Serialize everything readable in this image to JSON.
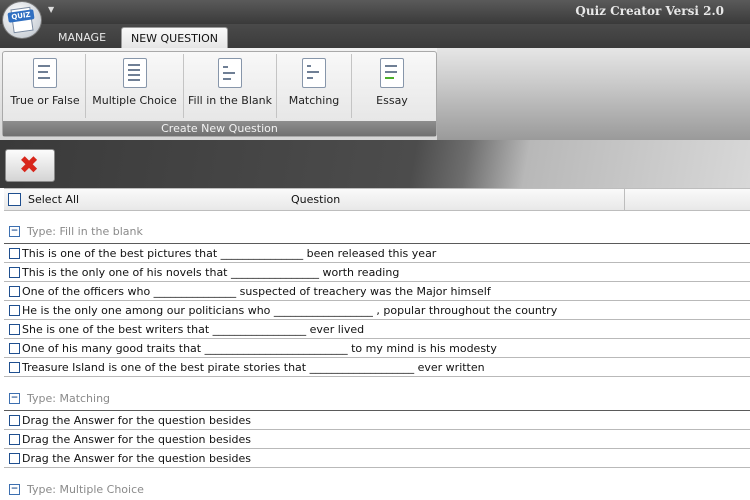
{
  "app": {
    "title": "Quiz Creator Versi 2.0",
    "icon_badge": "QUIZ"
  },
  "tabs": [
    {
      "label": "MANAGE"
    },
    {
      "label": "NEW QUESTION",
      "selected": true
    }
  ],
  "ribbon": {
    "group_label": "Create New Question",
    "buttons": [
      {
        "label": "True or False",
        "icon": "true-false-icon"
      },
      {
        "label": "Multiple Choice",
        "icon": "multiple-choice-icon"
      },
      {
        "label": "Fill in the Blank",
        "icon": "fill-blank-icon"
      },
      {
        "label": "Matching",
        "icon": "matching-icon"
      },
      {
        "label": "Essay",
        "icon": "essay-icon"
      }
    ]
  },
  "toolbar": {
    "delete_icon": "delete-icon",
    "delete_color": "#d8261b"
  },
  "grid": {
    "select_all_label": "Select All",
    "column_question": "Question",
    "groups": [
      {
        "title": "Type: Fill in the blank",
        "rows": [
          "This is one of the best pictures that _______________ been released this year",
          "This is the only one of his novels that ________________ worth reading",
          "One of the officers who _______________ suspected of treachery was the Major himself",
          "He is the only one among our politicians who __________________ , popular throughout the country",
          "She is one of the best writers that _________________ ever lived",
          "One of his many good traits that __________________________ to my mind is his modesty",
          "Treasure Island is one of the best pirate stories that ___________________ ever written"
        ]
      },
      {
        "title": "Type: Matching",
        "rows": [
          "Drag the Answer for the question besides",
          "Drag the Answer for the question besides",
          "Drag the Answer for the question besides"
        ]
      },
      {
        "title": "Type: Multiple Choice",
        "rows": []
      }
    ]
  }
}
